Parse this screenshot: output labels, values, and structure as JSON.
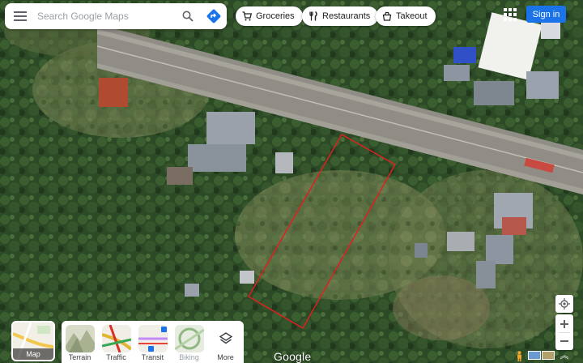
{
  "search": {
    "placeholder": "Search Google Maps"
  },
  "chips": [
    {
      "label": "Groceries",
      "icon": "cart-icon"
    },
    {
      "label": "Restaurants",
      "icon": "fork-knife-icon"
    },
    {
      "label": "Takeout",
      "icon": "takeout-icon"
    }
  ],
  "header": {
    "signin_label": "Sign in",
    "apps_icon": "apps-grid-icon"
  },
  "layers": {
    "main_label": "Map",
    "options": [
      "Terrain",
      "Traffic",
      "Transit",
      "Biking",
      "More"
    ]
  },
  "footer": {
    "logo_text": "Google"
  },
  "colors": {
    "accent": "#1a73e8",
    "boundary": "#e02020",
    "directions": "#1a73e8"
  }
}
